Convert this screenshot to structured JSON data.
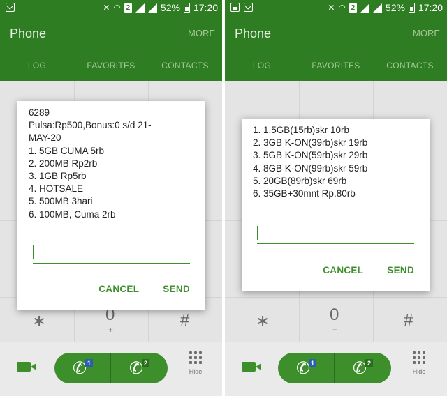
{
  "status_bar": {
    "battery": "52%",
    "time": "17:20",
    "sim_label": "2"
  },
  "app": {
    "title": "Phone",
    "more": "MORE",
    "tabs": [
      "LOG",
      "FAVORITES",
      "CONTACTS"
    ]
  },
  "dialpad": {
    "star": "∗",
    "zero": "0",
    "plus": "+",
    "hash": "#"
  },
  "bottom": {
    "sim1": "1",
    "sim2": "2",
    "hide_label": "Hide"
  },
  "left_dialog": {
    "lines": [
      "6289",
      "Pulsa:Rp500,Bonus:0 s/d 21-",
      "MAY-20",
      "1. 5GB CUMA 5rb",
      "2. 200MB Rp2rb",
      "3. 1GB Rp5rb",
      "4. HOTSALE",
      "5. 500MB 3hari",
      "6. 100MB, Cuma 2rb"
    ],
    "input_value": "",
    "cancel": "CANCEL",
    "send": "SEND"
  },
  "right_dialog": {
    "lines": [
      "1. 1.5GB(15rb)skr 10rb",
      "2. 3GB K-ON(39rb)skr 19rb",
      "3. 5GB K-ON(59rb)skr 29rb",
      "4. 8GB K-ON(99rb)skr 59rb",
      "5. 20GB(89rb)skr 69rb",
      "6. 35GB+30mnt Rp.80rb"
    ],
    "input_value": "",
    "cancel": "CANCEL",
    "send": "SEND"
  },
  "colors": {
    "app_bar": "#2f7d22",
    "accent": "#3d8f2c"
  }
}
